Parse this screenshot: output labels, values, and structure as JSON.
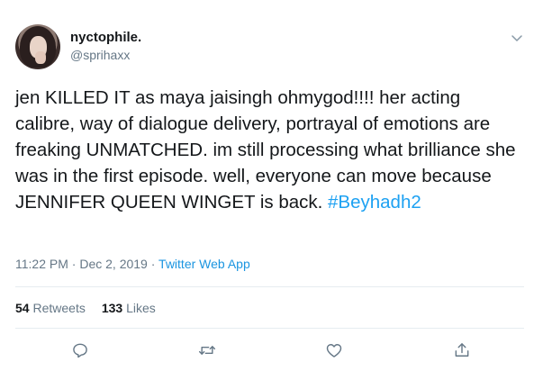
{
  "user": {
    "display_name": "nyctophile.",
    "handle": "@sprihaxx"
  },
  "tweet": {
    "text": "jen KILLED IT as maya jaisingh ohmygod!!!! her acting calibre, way of dialogue delivery, portrayal of emotions are freaking UNMATCHED. im still processing what brilliance she was in the first episode. well, everyone can move because JENNIFER QUEEN WINGET is back. ",
    "hashtag": "#Beyhadh2"
  },
  "meta": {
    "time": "11:22 PM",
    "separator_1": " · ",
    "date": "Dec 2, 2019",
    "separator_2": " · ",
    "source": "Twitter Web App"
  },
  "stats": {
    "retweets_count": "54",
    "retweets_label": "Retweets",
    "likes_count": "133",
    "likes_label": "Likes"
  },
  "actions": {
    "reply_icon": "reply-icon",
    "retweet_icon": "retweet-icon",
    "like_icon": "heart-icon",
    "share_icon": "share-icon",
    "menu_icon": "chevron-down-icon"
  },
  "colors": {
    "text": "#14171a",
    "secondary": "#657786",
    "link": "#1da1f2",
    "divider": "#e6ecf0"
  }
}
